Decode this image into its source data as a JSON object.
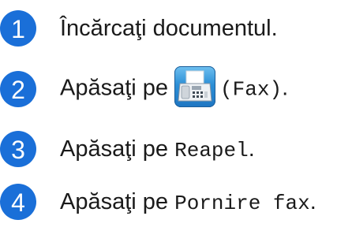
{
  "steps": [
    {
      "number": "1",
      "text": "Încărcaţi documentul."
    },
    {
      "number": "2",
      "prefix": "Apăsaţi pe",
      "icon": "fax-machine-icon",
      "mono": "(Fax)",
      "suffix": "."
    },
    {
      "number": "3",
      "prefix": "Apăsaţi pe",
      "mono": "Reapel",
      "suffix": "."
    },
    {
      "number": "4",
      "prefix": "Apăsaţi pe",
      "mono": "Pornire fax",
      "suffix": "."
    }
  ],
  "colors": {
    "badge": "#1a6fd8",
    "text": "#1a1a1a",
    "icon_button": "#2c8fd6"
  }
}
